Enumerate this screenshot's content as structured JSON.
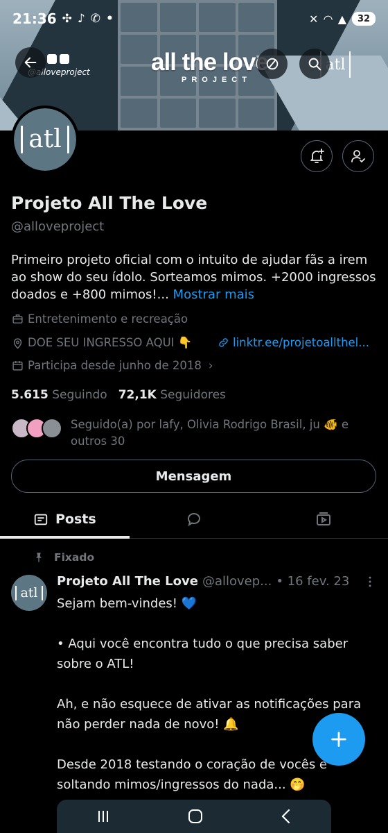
{
  "status_bar": {
    "time": "21:36",
    "battery": "32"
  },
  "banner": {
    "brand_title": "all the love",
    "brand_subtitle": "PROJECT",
    "handle_tag": "@alloveproject",
    "logo_text": "atl"
  },
  "profile": {
    "avatar_text": "atl",
    "name": "Projeto All The Love",
    "handle": "@alloveproject",
    "bio": "Primeiro projeto oficial com o intuito de ajudar fãs a irem ao show do seu ídolo. Sorteamos mimos. +2000 ingressos doados e +800 mimos!...",
    "bio_more": "Mostrar mais",
    "category": "Entretenimento e recreação",
    "location": "DOE SEU INGRESSO AQUI 👇",
    "link": "linktr.ee/projetoallthel...",
    "joined": "Participa desde junho de 2018",
    "following_count": "5.615",
    "following_label": "Seguindo",
    "followers_count": "72,1K",
    "followers_label": "Seguidores",
    "followed_by": "Seguido(a) por lafy, Olivia Rodrigo Brasil, ju 🐠 e outros 30",
    "message_button": "Mensagem"
  },
  "tabs": {
    "posts": "Posts"
  },
  "post": {
    "pinned_label": "Fixado",
    "avatar_text": "atl",
    "author_name": "Projeto All The Love",
    "author_handle": "@allovep...",
    "date": "• 16 fev. 23",
    "lines": [
      "Sejam bem-vindes! 💙",
      "",
      "•  Aqui você encontra tudo o que precisa saber sobre o ATL!",
      "",
      "Ah, e não esquece de ativar as notificações para não perder nada de novo!  🔔",
      "",
      "Desde 2018 testando o coração de vocês e soltando mimos/ingressos do nada... 🤭"
    ]
  },
  "colors": {
    "accent": "#1d9bf0",
    "background": "#000000",
    "muted": "#71767b",
    "text": "#e7e9ea"
  }
}
